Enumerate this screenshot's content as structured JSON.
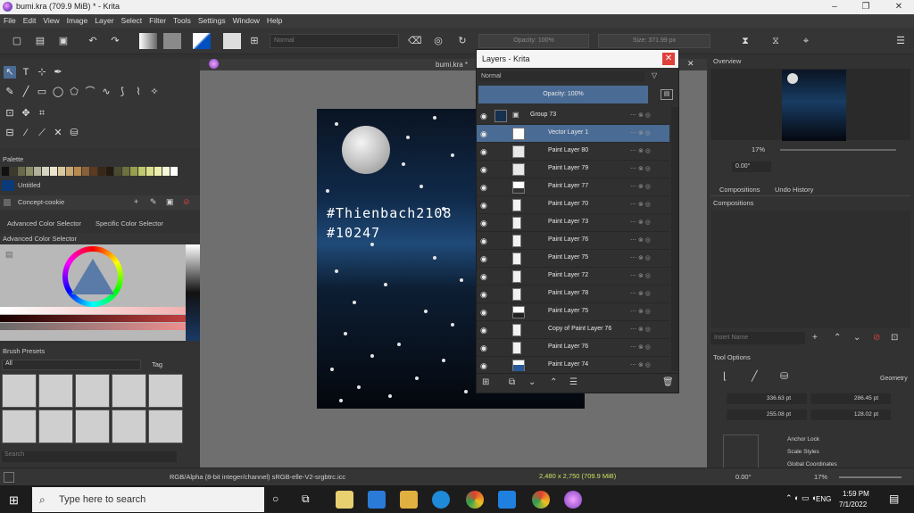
{
  "window": {
    "title": "bumi.kra (709.9 MiB) * - Krita",
    "controls": [
      "–",
      "❐",
      "✕"
    ]
  },
  "menu": [
    "File",
    "Edit",
    "View",
    "Image",
    "Layer",
    "Select",
    "Filter",
    "Tools",
    "Settings",
    "Window",
    "Help"
  ],
  "toolbar": {
    "blend_mode": "Normal",
    "opacity": "Opacity: 100%",
    "size": "Size: 371.99 px"
  },
  "palette": {
    "title": "Palette",
    "name": "Untitled",
    "concept": "Concept-cookie"
  },
  "color_tabs": [
    "Advanced Color Selector",
    "Specific Color Selector"
  ],
  "advanced_color_selector": "Advanced Color Selector",
  "brush_presets": {
    "title": "Brush Presets",
    "filter": "All",
    "tag": "Tag",
    "search": "Search"
  },
  "document": {
    "tab": "bumi.kra *",
    "text_line1": "#Thienbach2108",
    "text_line2": "#10247"
  },
  "layers_docker": {
    "title": "Layers - Krita",
    "blend_mode": "Normal",
    "opacity": "Opacity: 100%",
    "layers": [
      {
        "name": "Group 73",
        "selected": false
      },
      {
        "name": "Vector Layer 1",
        "selected": true
      },
      {
        "name": "Paint Layer 80",
        "selected": false
      },
      {
        "name": "Paint Layer 79",
        "selected": false
      },
      {
        "name": "Paint Layer 77",
        "selected": false
      },
      {
        "name": "Paint Layer 70",
        "selected": false
      },
      {
        "name": "Paint Layer 73",
        "selected": false
      },
      {
        "name": "Paint Layer 76",
        "selected": false
      },
      {
        "name": "Paint Layer 75",
        "selected": false
      },
      {
        "name": "Paint Layer 72",
        "selected": false
      },
      {
        "name": "Paint Layer 78",
        "selected": false
      },
      {
        "name": "Paint Layer 75",
        "selected": false
      },
      {
        "name": "Copy of Paint Layer 76",
        "selected": false
      },
      {
        "name": "Paint Layer 76",
        "selected": false
      },
      {
        "name": "Paint Layer 74",
        "selected": false
      }
    ]
  },
  "right_dock": {
    "overview": "Overview",
    "zoom": "17%",
    "rotation": "0.00°",
    "tabs": [
      "Compositions",
      "Undo History"
    ],
    "compositions": "Compositions",
    "insert_name": "Insert Name",
    "tool_options": "Tool Options",
    "geometry": "Geometry",
    "x": "336.63 pt",
    "y": "255.08 pt",
    "w": "286.45 pt",
    "h": "128.02 pt",
    "anchor_lock": "Anchor Lock",
    "scale_styles": "Scale Styles",
    "global_coords": "Global Coordinates"
  },
  "status": {
    "color_model": "RGB/Alpha (8-bit integer/channel)  sRGB-elle-V2-srgbtrc.icc",
    "dimensions": "2,480 x 2,750 (709.9 MiB)",
    "rotation": "0.00°",
    "zoom": "17%"
  },
  "taskbar": {
    "search_placeholder": "Type here to search",
    "time": "1:59 PM",
    "date": "7/1/2022",
    "lang": "ENG"
  },
  "colors": {
    "accent": "#4a6b94",
    "close_red": "#e0403a",
    "canvas_bg": "#6f6f6f"
  }
}
